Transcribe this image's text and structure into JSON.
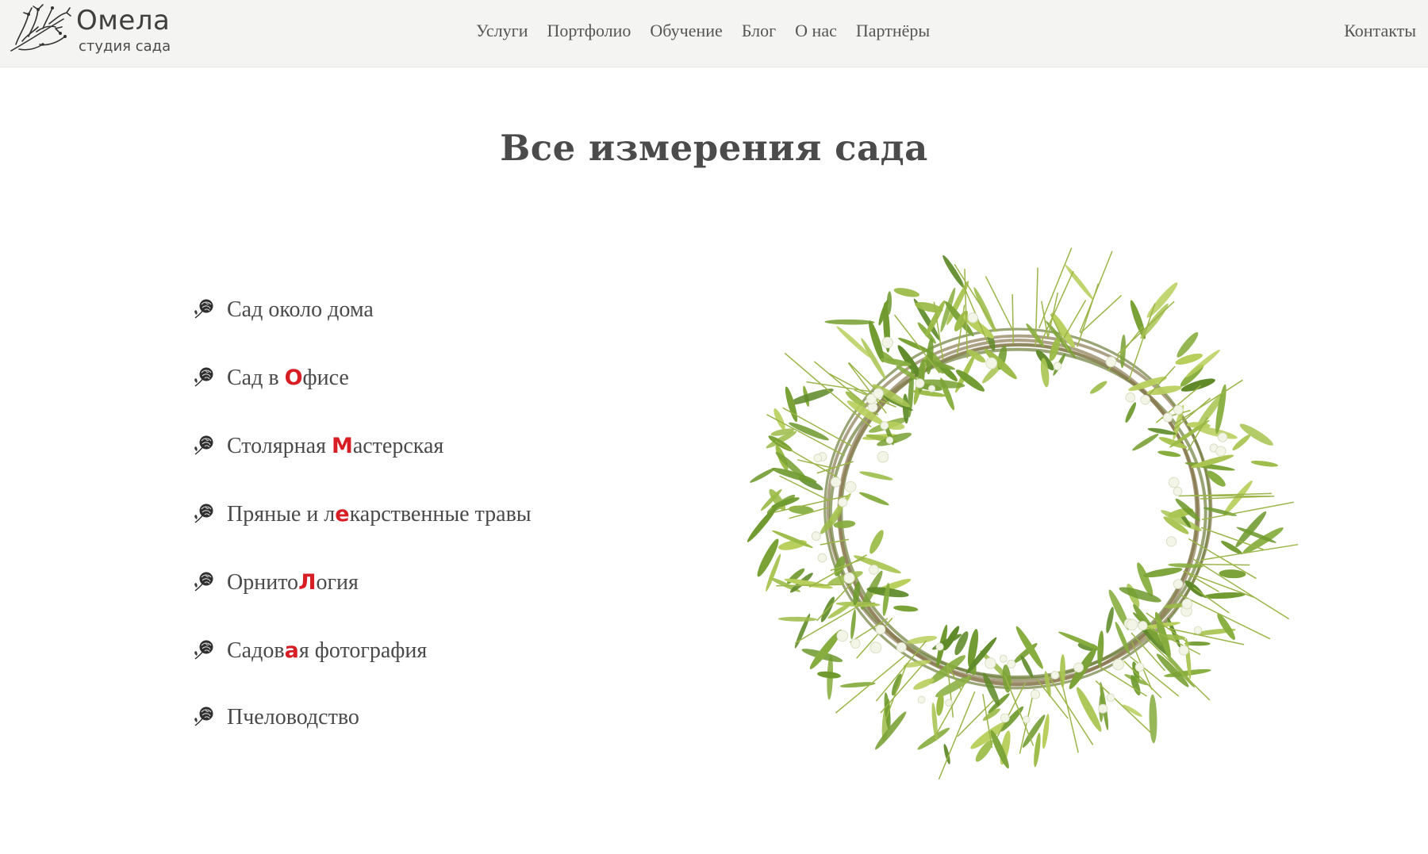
{
  "brand": {
    "title": "Омела",
    "subtitle": "студия сада"
  },
  "nav": {
    "items": [
      "Услуги",
      "Портфолио",
      "Обучение",
      "Блог",
      "О нас",
      "Партнёры"
    ],
    "contacts": "Контакты"
  },
  "headline": "Все измерения сада",
  "services": [
    {
      "before": "Сад около дома",
      "accent": "",
      "after": ""
    },
    {
      "before": "Сад в ",
      "accent": "О",
      "after": "фисе"
    },
    {
      "before": "Столярная ",
      "accent": "М",
      "after": "астерская"
    },
    {
      "before": "Пряные и л",
      "accent": "е",
      "after": "карственные травы"
    },
    {
      "before": "Орнито",
      "accent": "Л",
      "after": "огия"
    },
    {
      "before": "Садов",
      "accent": "а",
      "after": "я фотография"
    },
    {
      "before": "Пчеловодство",
      "accent": "",
      "after": ""
    }
  ],
  "colors": {
    "topbar": "#f4f4f2",
    "accent": "#d71e24",
    "text": "#4a4a4a",
    "leaf": "#7ea23a"
  },
  "icons": {
    "logo": "mistletoe-branch-icon",
    "bullet": "rose-icon"
  }
}
